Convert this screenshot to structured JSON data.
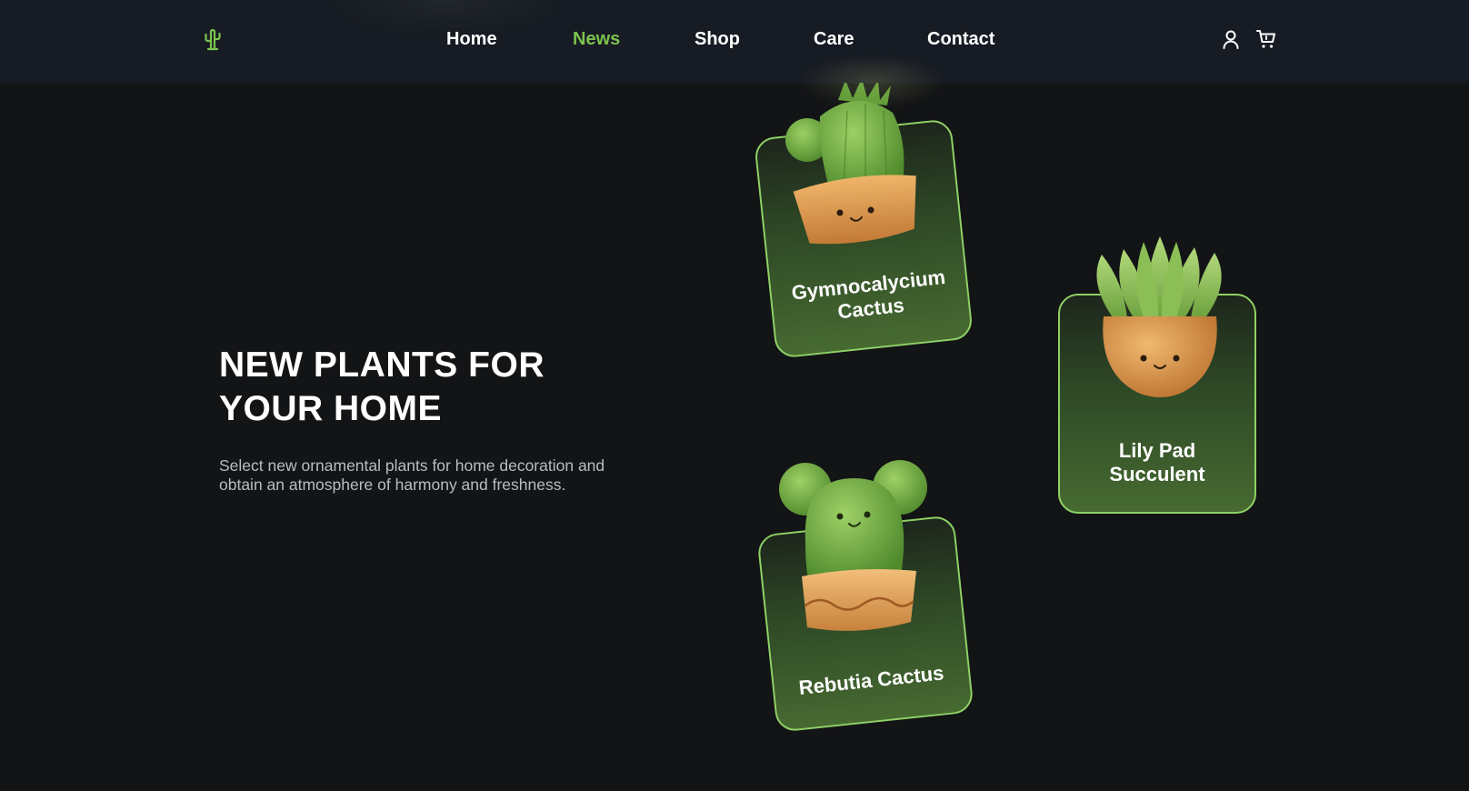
{
  "header": {
    "logo_icon": "cactus-icon",
    "nav": [
      {
        "label": "Home",
        "active": false
      },
      {
        "label": "News",
        "active": true
      },
      {
        "label": "Shop",
        "active": false
      },
      {
        "label": "Care",
        "active": false
      },
      {
        "label": "Contact",
        "active": false
      }
    ],
    "icons": [
      "user-icon",
      "cart-icon"
    ]
  },
  "hero": {
    "title_line1": "NEW PLANTS FOR",
    "title_line2": "YOUR HOME",
    "subtitle": "Select new ornamental plants for home decoration and obtain an atmosphere of harmony and freshness."
  },
  "cards": [
    {
      "label_line1": "Gymnocalycium",
      "label_line2": "Cactus"
    },
    {
      "label_line1": "Lily Pad",
      "label_line2": "Succulent"
    },
    {
      "label_line1": "Rebutia Cactus",
      "label_line2": ""
    }
  ],
  "colors": {
    "background": "#131416",
    "header": "#171b23",
    "accent": "#7cc34f",
    "card_border": "#8fd165",
    "card_fill": "#476a31",
    "pot": "#d99a4e"
  }
}
